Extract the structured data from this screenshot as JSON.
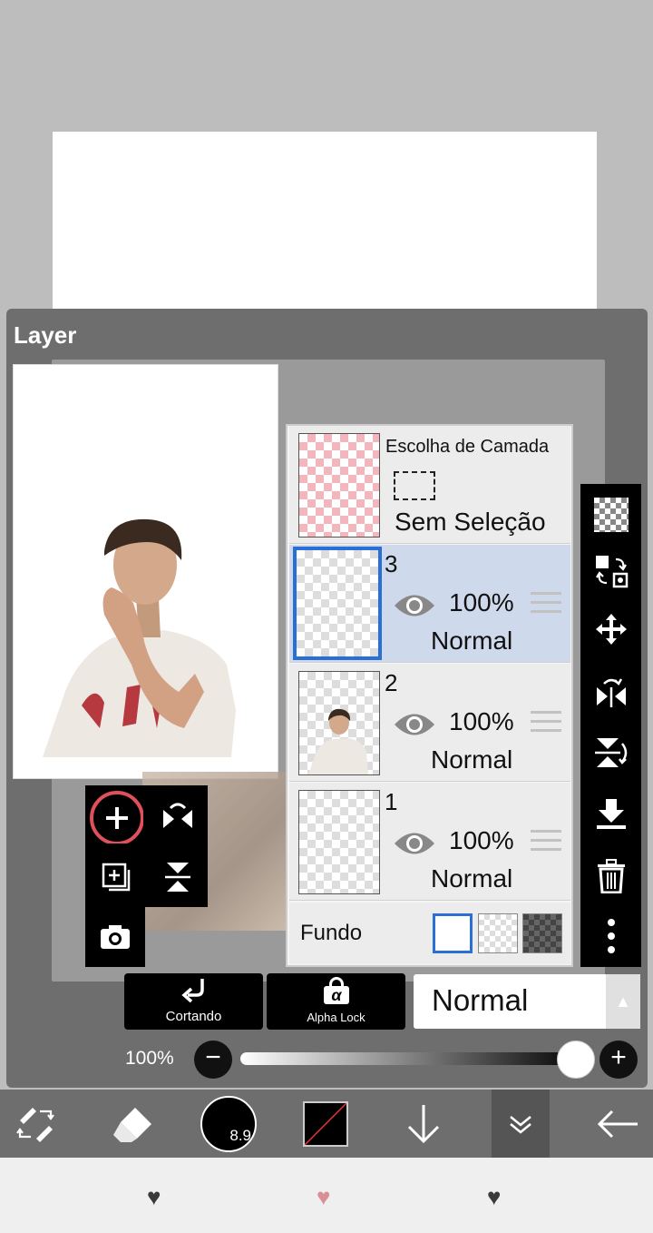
{
  "panel": {
    "title": "Layer"
  },
  "layers": {
    "selection": {
      "title": "Escolha de Camada",
      "status": "Sem Seleção"
    },
    "items": [
      {
        "number": "3",
        "opacity": "100%",
        "blend": "Normal",
        "selected": true
      },
      {
        "number": "2",
        "opacity": "100%",
        "blend": "Normal",
        "selected": false
      },
      {
        "number": "1",
        "opacity": "100%",
        "blend": "Normal",
        "selected": false
      }
    ],
    "background": {
      "label": "Fundo"
    }
  },
  "bottom": {
    "clipping_label": "Cortando",
    "alpha_lock_label": "Alpha Lock",
    "alpha_symbol": "α",
    "blend_mode": "Normal",
    "opacity_label": "100%",
    "opacity_value": 1.0
  },
  "toolbar": {
    "brush_size": "8.9"
  },
  "colors": {
    "accent": "#2a6fd6",
    "annotation_circle": "#e0505a",
    "heart_pink": "#d98f95",
    "heart_dark": "#3a3a3a"
  }
}
